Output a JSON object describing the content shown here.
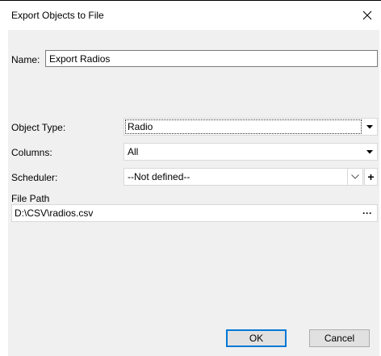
{
  "dialog": {
    "title": "Export Objects to File"
  },
  "form": {
    "name_label": "Name:",
    "name_value": "Export Radios",
    "object_type_label": "Object Type:",
    "object_type_value": "Radio",
    "columns_label": "Columns:",
    "columns_value": "All",
    "scheduler_label": "Scheduler:",
    "scheduler_value": "--Not defined--",
    "scheduler_add": "+",
    "file_path_label": "File Path",
    "file_path_value": "D:\\CSV\\radios.csv",
    "browse_label": "···"
  },
  "buttons": {
    "ok": "OK",
    "cancel": "Cancel"
  },
  "colors": {
    "accent": "#0078d7",
    "dialog_bg": "#f0f0f0",
    "border": "#7a7a7a"
  },
  "icons": {
    "close": "close-icon",
    "dropdown": "chevron-down-icon",
    "add": "plus-icon",
    "browse": "ellipsis-icon"
  }
}
